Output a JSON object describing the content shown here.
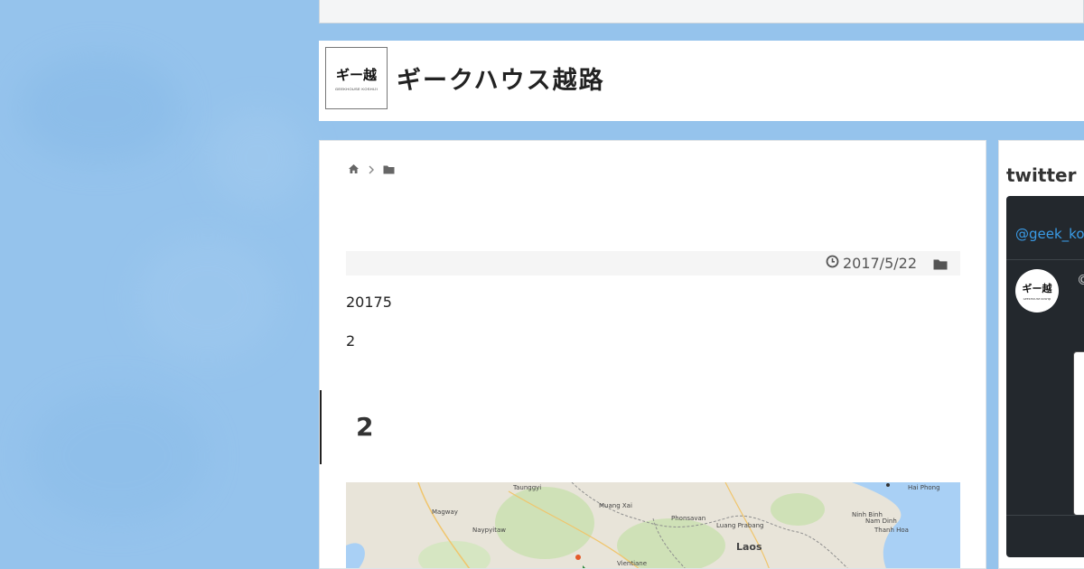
{
  "site": {
    "logo_main": "ギー越",
    "logo_sub": "GEEKHOUSE KOSHIJI",
    "title": "ギークハウス越路"
  },
  "breadcrumb": {
    "home_icon": "home-icon",
    "separator_icon": "chevron-right-icon",
    "folder_icon": "folder-icon"
  },
  "post": {
    "date": "2017/5/22",
    "paragraph_1": "20175",
    "paragraph_2": "2",
    "heading": "2"
  },
  "map": {
    "labels": [
      "Hai Phong",
      "Laos",
      "Naypyitaw",
      "Magway",
      "Taunggyi",
      "Luang Prabang",
      "Thanh Hoa",
      "Ninh Binh",
      "Nam Dinh",
      "Muang Xai",
      "Phonsavan",
      "Vientiane"
    ]
  },
  "sidebar": {
    "twitter_title": "twitter",
    "twitter_handle": "@geek_kos",
    "twitter_avatar_main": "ギー越",
    "twitter_avatar_sub": "GEEKHOUSE KOSHIJI",
    "twitter_glyph": "©"
  },
  "colors": {
    "background": "#95c3ec",
    "link": "#3a9be6",
    "widget_dark": "#23282d"
  }
}
